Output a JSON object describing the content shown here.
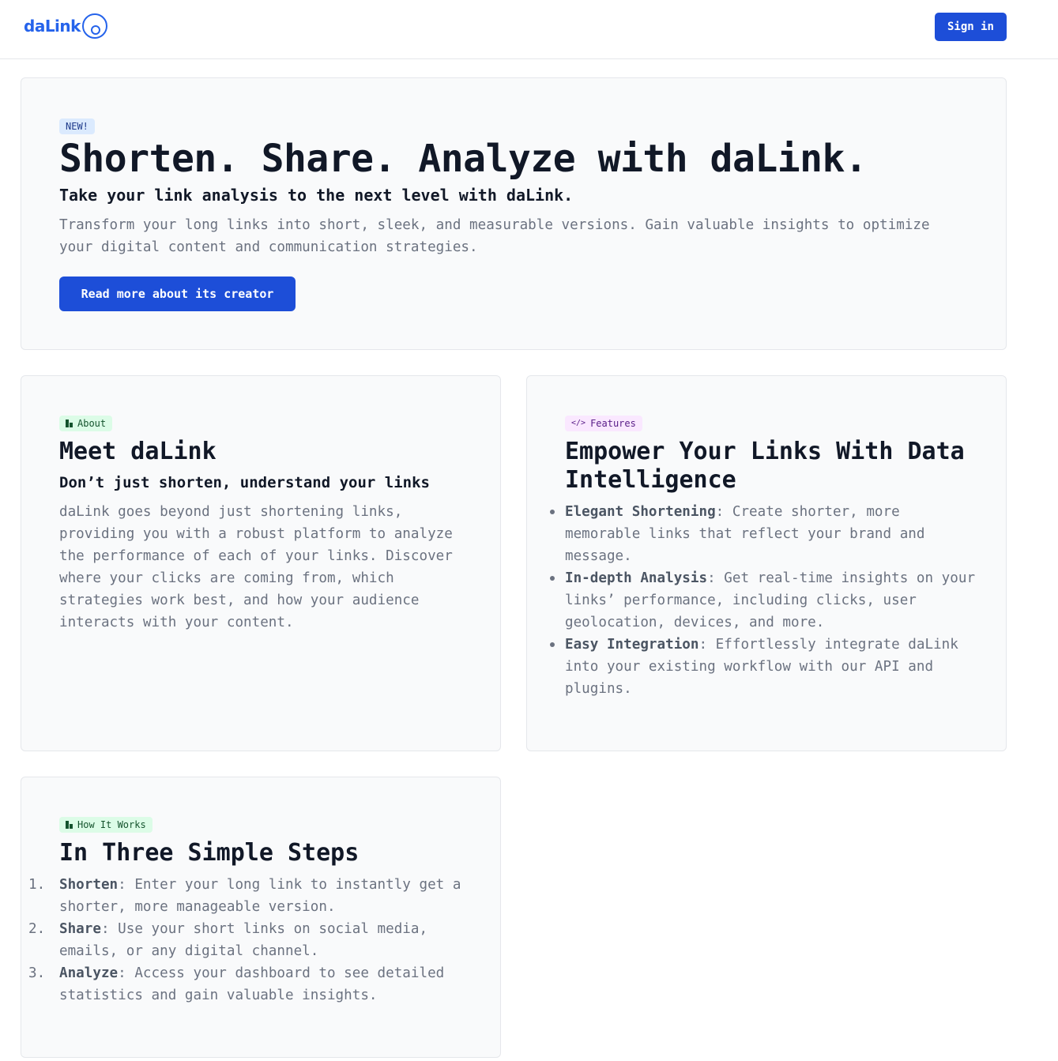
{
  "header": {
    "logo_text": "daLink",
    "signin_label": "Sign in"
  },
  "hero": {
    "badge": "NEW!",
    "title": "Shorten. Share. Analyze with daLink.",
    "subtitle": "Take your link analysis to the next level with daLink.",
    "description": "Transform your long links into short, sleek, and measurable versions. Gain valuable insights to optimize your digital content and communication strategies.",
    "cta_label": "Read more about its creator"
  },
  "about": {
    "badge": "About",
    "title": "Meet daLink",
    "subtitle": "Don’t just shorten, understand your links",
    "body": "daLink goes beyond just shortening links, providing you with a robust platform to analyze the performance of each of your links. Discover where your clicks are coming from, which strategies work best, and how your audience interacts with your content."
  },
  "features": {
    "badge": "Features",
    "title": "Empower Your Links With Data Intelligence",
    "items": [
      {
        "label": "Elegant Shortening",
        "text": ": Create shorter, more memorable links that reflect your brand and message."
      },
      {
        "label": "In-depth Analysis",
        "text": ": Get real-time insights on your links’ performance, including clicks, user geolocation, devices, and more."
      },
      {
        "label": "Easy Integration",
        "text": ": Effortlessly integrate daLink into your existing workflow with our API and plugins."
      }
    ]
  },
  "how": {
    "badge": "How It Works",
    "title": "In Three Simple Steps",
    "steps": [
      {
        "num": "1.",
        "label": "Shorten",
        "text": ": Enter your long link to instantly get a shorter, more manageable version."
      },
      {
        "num": "2.",
        "label": "Share",
        "text": ": Use your short links on social media, emails, or any digital channel."
      },
      {
        "num": "3.",
        "label": "Analyze",
        "text": ": Access your dashboard to see detailed statistics and gain valuable insights."
      }
    ]
  },
  "colors": {
    "primary": "#1d4ed8",
    "brand": "#2563eb",
    "card_bg": "#f9fafb"
  }
}
